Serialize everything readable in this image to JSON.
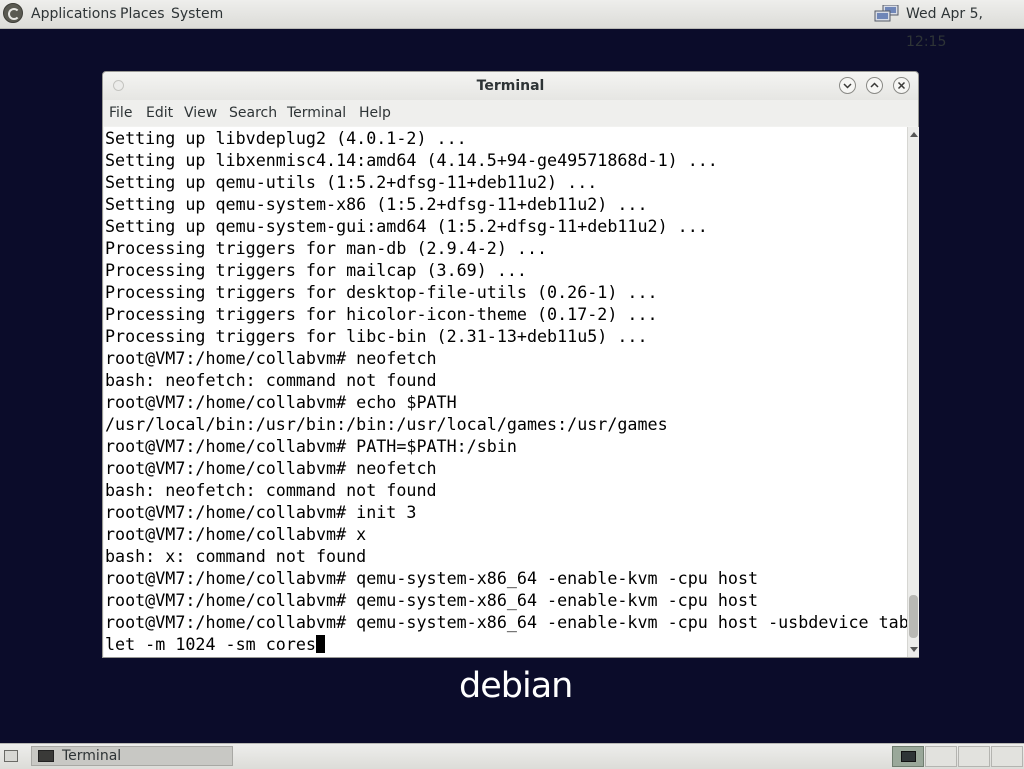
{
  "top_panel": {
    "menus": [
      "Applications",
      "Places",
      "System"
    ],
    "clock": "Wed Apr  5, 12:15",
    "icons": {
      "logo": "distro-logo-icon",
      "network": "network-icon"
    }
  },
  "window": {
    "title": "Terminal",
    "controls": {
      "minimize": "chevron-down-icon",
      "maximize": "chevron-up-icon",
      "close": "close-icon"
    },
    "menu": [
      "File",
      "Edit",
      "View",
      "Search",
      "Terminal",
      "Help"
    ]
  },
  "terminal": {
    "lines": [
      "Setting up libvdeplug2 (4.0.1-2) ...",
      "Setting up libxenmisc4.14:amd64 (4.14.5+94-ge49571868d-1) ...",
      "Setting up qemu-utils (1:5.2+dfsg-11+deb11u2) ...",
      "Setting up qemu-system-x86 (1:5.2+dfsg-11+deb11u2) ...",
      "Setting up qemu-system-gui:amd64 (1:5.2+dfsg-11+deb11u2) ...",
      "Processing triggers for man-db (2.9.4-2) ...",
      "Processing triggers for mailcap (3.69) ...",
      "Processing triggers for desktop-file-utils (0.26-1) ...",
      "Processing triggers for hicolor-icon-theme (0.17-2) ...",
      "Processing triggers for libc-bin (2.31-13+deb11u5) ...",
      "root@VM7:/home/collabvm# neofetch",
      "bash: neofetch: command not found",
      "root@VM7:/home/collabvm# echo $PATH",
      "/usr/local/bin:/usr/bin:/bin:/usr/local/games:/usr/games",
      "root@VM7:/home/collabvm# PATH=$PATH:/sbin",
      "root@VM7:/home/collabvm# neofetch",
      "bash: neofetch: command not found",
      "root@VM7:/home/collabvm# init 3",
      "root@VM7:/home/collabvm# x",
      "bash: x: command not found",
      "root@VM7:/home/collabvm# qemu-system-x86_64 -enable-kvm -cpu host",
      "root@VM7:/home/collabvm# qemu-system-x86_64 -enable-kvm -cpu host",
      "root@VM7:/home/collabvm# qemu-system-x86_64 -enable-kvm -cpu host -usbdevice tab",
      "let -m 1024 -sm cores"
    ]
  },
  "desktop": {
    "wallpaper_logo": "debian",
    "background_color": "#0b0c2a"
  },
  "bottom_panel": {
    "task_label": "Terminal",
    "icons": {
      "show_desktop": "show-desktop-icon",
      "task": "terminal-icon"
    },
    "workspaces": 4
  }
}
